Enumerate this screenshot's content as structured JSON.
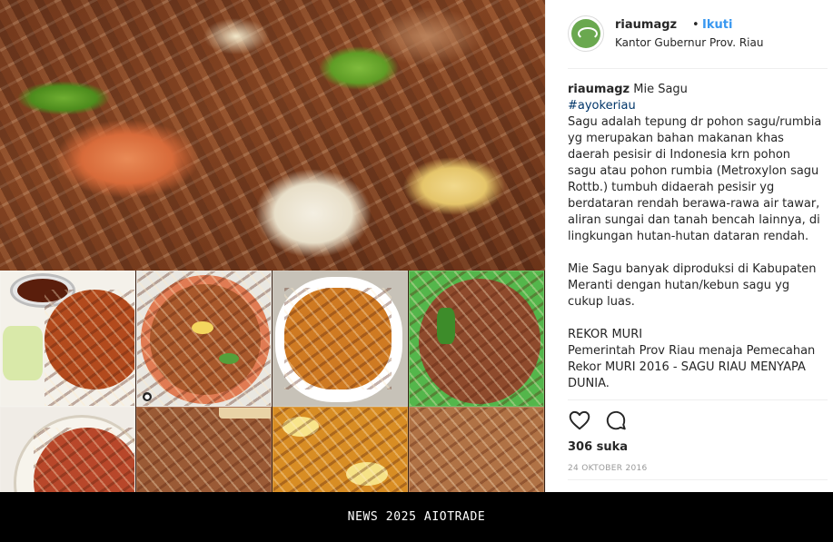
{
  "post": {
    "author": {
      "username": "riaumagz",
      "separator": "•",
      "follow_label": "Ikuti",
      "location": "Kantor Gubernur Prov. Riau",
      "avatar_icon": "riau-magz-logo-icon"
    },
    "caption": {
      "username": "riaumagz",
      "title": "Mie Sagu",
      "hashtag": "#ayokeriau",
      "body": "Sagu adalah tepung dr pohon sagu/rumbia yg merupakan bahan makanan khas daerah pesisir di Indonesia krn pohon sagu atau pohon rumbia (Metroxylon sagu Rottb.) tumbuh didaerah pesisir yg berdataran rendah berawa-rawa air tawar, aliran sungai dan tanah bencah lainnya, di lingkungan hutan-hutan dataran rendah.\n\nMie Sagu banyak diproduksi di Kabupaten Meranti dengan hutan/kebun sagu yg cukup luas.\n\nREKOR MURI\nPemerintah Prov Riau menaja Pemecahan Rekor MURI 2016 - SAGU RIAU MENYAPA DUNIA."
    },
    "actions": {
      "like_icon": "heart-icon",
      "comment_icon": "comment-bubble-icon"
    },
    "likes_label": "306 suka",
    "date_label": "24 OKTOBER 2016"
  },
  "colors": {
    "follow": "#3897f0",
    "hashtag": "#003569",
    "text": "#262626",
    "muted": "#999999",
    "footer_bg": "#000000"
  },
  "footer": {
    "text": "NEWS 2025 AIOTRADE"
  }
}
